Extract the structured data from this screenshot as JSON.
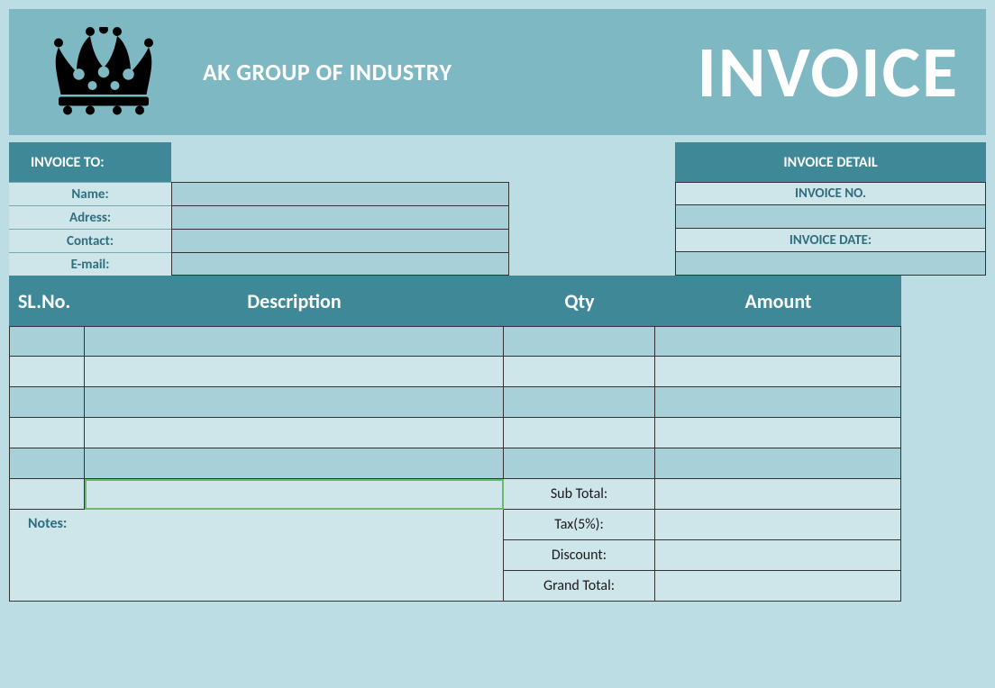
{
  "header": {
    "company": "AK GROUP OF INDUSTRY",
    "title": "INVOICE"
  },
  "invoice_to": {
    "heading": "INVOICE TO:",
    "fields": [
      {
        "label": "Name:",
        "value": ""
      },
      {
        "label": "Adress:",
        "value": ""
      },
      {
        "label": "Contact:",
        "value": ""
      },
      {
        "label": "E-mail:",
        "value": ""
      }
    ]
  },
  "invoice_detail": {
    "heading": "INVOICE DETAIL",
    "rows": [
      {
        "label": "INVOICE NO.",
        "value": ""
      },
      {
        "label": "",
        "value": ""
      },
      {
        "label": "INVOICE DATE:",
        "value": ""
      },
      {
        "label": "",
        "value": ""
      }
    ]
  },
  "items": {
    "headers": {
      "sl": "SL.No.",
      "desc": "Description",
      "qty": "Qty",
      "amt": "Amount"
    },
    "rows": [
      {
        "sl": "",
        "desc": "",
        "qty": "",
        "amt": ""
      },
      {
        "sl": "",
        "desc": "",
        "qty": "",
        "amt": ""
      },
      {
        "sl": "",
        "desc": "",
        "qty": "",
        "amt": ""
      },
      {
        "sl": "",
        "desc": "",
        "qty": "",
        "amt": ""
      },
      {
        "sl": "",
        "desc": "",
        "qty": "",
        "amt": ""
      },
      {
        "sl": "",
        "desc": "",
        "qty": "",
        "amt": ""
      }
    ]
  },
  "totals": {
    "subtotal_label": "Sub Total:",
    "tax_label": "Tax(5%):",
    "discount_label": "Discount:",
    "grand_label": "Grand Total:",
    "subtotal": "",
    "tax": "",
    "discount": "",
    "grand": ""
  },
  "notes": {
    "label": "Notes:",
    "text": ""
  },
  "colors": {
    "dark_teal": "#3e8898",
    "mid_teal": "#7eb8c2",
    "light_teal": "#bcdde3",
    "cell_light": "#cee5ea",
    "cell_mid": "#a7d0d8"
  }
}
